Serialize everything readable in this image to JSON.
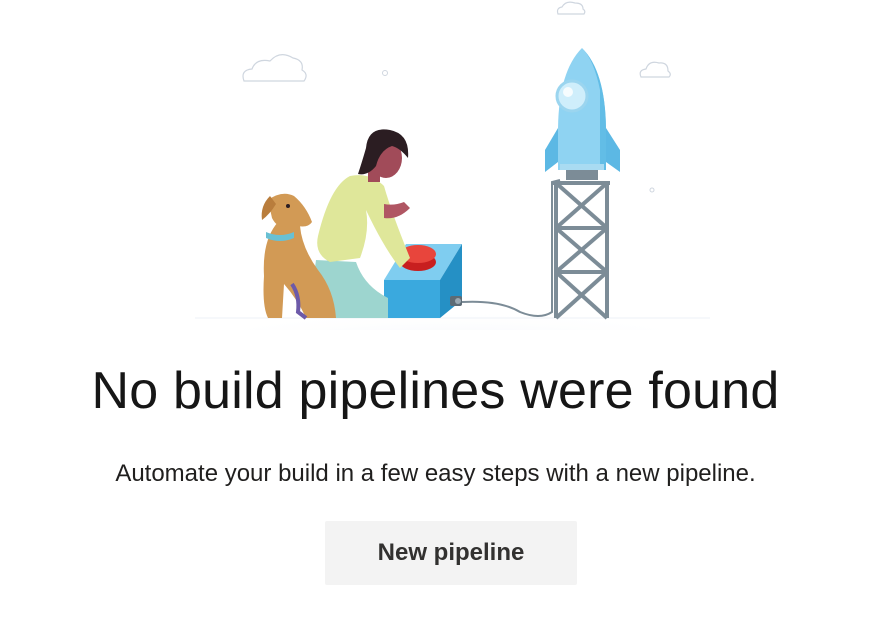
{
  "empty_state": {
    "title": "No build pipelines were found",
    "description": "Automate your build in a few easy steps with a new pipeline.",
    "primary_action": "New pipeline"
  },
  "illustration": {
    "subject": "person-with-dog-pressing-launch-button-rocket"
  },
  "colors": {
    "button_background": "#f3f3f3",
    "title_text": "#161616",
    "rocket_blue": "#7ccbef",
    "box_blue": "#3aa9de"
  }
}
